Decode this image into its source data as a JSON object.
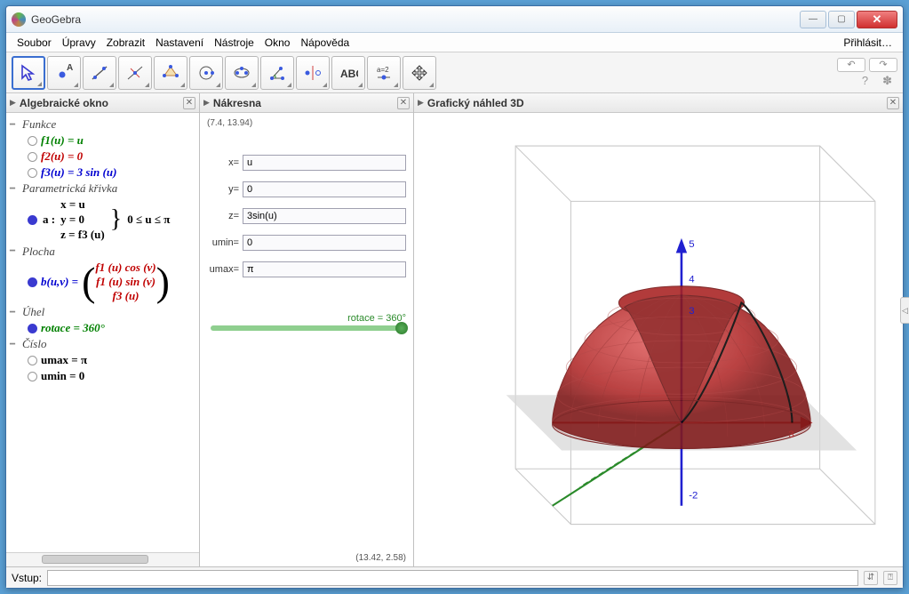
{
  "window": {
    "title": "GeoGebra"
  },
  "menu": {
    "items": [
      "Soubor",
      "Úpravy",
      "Zobrazit",
      "Nastavení",
      "Nástroje",
      "Okno",
      "Nápověda"
    ],
    "right": "Přihlásit…"
  },
  "panels": {
    "algebra": {
      "title": "Algebraické okno"
    },
    "canvas": {
      "title": "Nákresna",
      "coord_tl": "(7.4, 13.94)",
      "coord_br": "(13.42, 2.58)"
    },
    "view3d": {
      "title": "Grafický náhled 3D"
    }
  },
  "algebra": {
    "cat_func": "Funkce",
    "f1": "f1(u)  =  u",
    "f2": "f2(u)  =  0",
    "f3": "f3(u)  =  3 sin (u)",
    "cat_curve": "Parametrická křivka",
    "curve_name": "a :",
    "curve_x": "x = u",
    "curve_y": "y = 0",
    "curve_z": "z = f3 (u)",
    "curve_cond": "0 ≤ u ≤ π",
    "cat_surface": "Plocha",
    "surf_name": "b(u,v)  =",
    "surf_r1": "f1 (u) cos (v)",
    "surf_r2": "f1 (u) sin (v)",
    "surf_r3": "f3 (u)",
    "cat_angle": "Úhel",
    "angle": "rotace = 360°",
    "cat_num": "Číslo",
    "num1": "umax = π",
    "num2": "umin = 0"
  },
  "fields": {
    "x_label": "x=",
    "x": "u",
    "y_label": "y=",
    "y": "0",
    "z_label": "z=",
    "z": "3sin(u)",
    "umin_label": "umin=",
    "umin": "0",
    "umax_label": "umax=",
    "umax": "π"
  },
  "slider": {
    "label": "rotace = 360°"
  },
  "inputbar": {
    "label": "Vstup:"
  },
  "axis3d": {
    "y5": "5",
    "y4": "4",
    "y3": "3",
    "ym2": "-2",
    "x3": "3"
  }
}
